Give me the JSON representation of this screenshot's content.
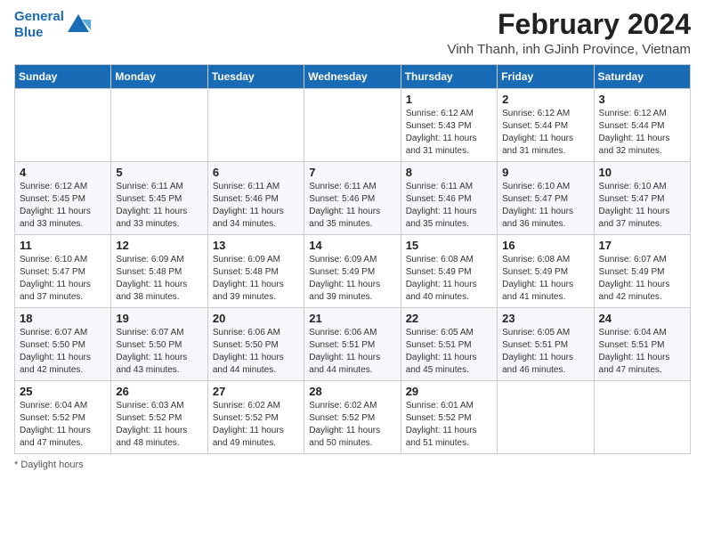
{
  "header": {
    "logo_line1": "General",
    "logo_line2": "Blue",
    "title": "February 2024",
    "subtitle": "Vinh Thanh, inh GJinh Province, Vietnam"
  },
  "columns": [
    "Sunday",
    "Monday",
    "Tuesday",
    "Wednesday",
    "Thursday",
    "Friday",
    "Saturday"
  ],
  "weeks": [
    [
      {
        "day": "",
        "info": ""
      },
      {
        "day": "",
        "info": ""
      },
      {
        "day": "",
        "info": ""
      },
      {
        "day": "",
        "info": ""
      },
      {
        "day": "1",
        "info": "Sunrise: 6:12 AM\nSunset: 5:43 PM\nDaylight: 11 hours and 31 minutes."
      },
      {
        "day": "2",
        "info": "Sunrise: 6:12 AM\nSunset: 5:44 PM\nDaylight: 11 hours and 31 minutes."
      },
      {
        "day": "3",
        "info": "Sunrise: 6:12 AM\nSunset: 5:44 PM\nDaylight: 11 hours and 32 minutes."
      }
    ],
    [
      {
        "day": "4",
        "info": "Sunrise: 6:12 AM\nSunset: 5:45 PM\nDaylight: 11 hours and 33 minutes."
      },
      {
        "day": "5",
        "info": "Sunrise: 6:11 AM\nSunset: 5:45 PM\nDaylight: 11 hours and 33 minutes."
      },
      {
        "day": "6",
        "info": "Sunrise: 6:11 AM\nSunset: 5:46 PM\nDaylight: 11 hours and 34 minutes."
      },
      {
        "day": "7",
        "info": "Sunrise: 6:11 AM\nSunset: 5:46 PM\nDaylight: 11 hours and 35 minutes."
      },
      {
        "day": "8",
        "info": "Sunrise: 6:11 AM\nSunset: 5:46 PM\nDaylight: 11 hours and 35 minutes."
      },
      {
        "day": "9",
        "info": "Sunrise: 6:10 AM\nSunset: 5:47 PM\nDaylight: 11 hours and 36 minutes."
      },
      {
        "day": "10",
        "info": "Sunrise: 6:10 AM\nSunset: 5:47 PM\nDaylight: 11 hours and 37 minutes."
      }
    ],
    [
      {
        "day": "11",
        "info": "Sunrise: 6:10 AM\nSunset: 5:47 PM\nDaylight: 11 hours and 37 minutes."
      },
      {
        "day": "12",
        "info": "Sunrise: 6:09 AM\nSunset: 5:48 PM\nDaylight: 11 hours and 38 minutes."
      },
      {
        "day": "13",
        "info": "Sunrise: 6:09 AM\nSunset: 5:48 PM\nDaylight: 11 hours and 39 minutes."
      },
      {
        "day": "14",
        "info": "Sunrise: 6:09 AM\nSunset: 5:49 PM\nDaylight: 11 hours and 39 minutes."
      },
      {
        "day": "15",
        "info": "Sunrise: 6:08 AM\nSunset: 5:49 PM\nDaylight: 11 hours and 40 minutes."
      },
      {
        "day": "16",
        "info": "Sunrise: 6:08 AM\nSunset: 5:49 PM\nDaylight: 11 hours and 41 minutes."
      },
      {
        "day": "17",
        "info": "Sunrise: 6:07 AM\nSunset: 5:49 PM\nDaylight: 11 hours and 42 minutes."
      }
    ],
    [
      {
        "day": "18",
        "info": "Sunrise: 6:07 AM\nSunset: 5:50 PM\nDaylight: 11 hours and 42 minutes."
      },
      {
        "day": "19",
        "info": "Sunrise: 6:07 AM\nSunset: 5:50 PM\nDaylight: 11 hours and 43 minutes."
      },
      {
        "day": "20",
        "info": "Sunrise: 6:06 AM\nSunset: 5:50 PM\nDaylight: 11 hours and 44 minutes."
      },
      {
        "day": "21",
        "info": "Sunrise: 6:06 AM\nSunset: 5:51 PM\nDaylight: 11 hours and 44 minutes."
      },
      {
        "day": "22",
        "info": "Sunrise: 6:05 AM\nSunset: 5:51 PM\nDaylight: 11 hours and 45 minutes."
      },
      {
        "day": "23",
        "info": "Sunrise: 6:05 AM\nSunset: 5:51 PM\nDaylight: 11 hours and 46 minutes."
      },
      {
        "day": "24",
        "info": "Sunrise: 6:04 AM\nSunset: 5:51 PM\nDaylight: 11 hours and 47 minutes."
      }
    ],
    [
      {
        "day": "25",
        "info": "Sunrise: 6:04 AM\nSunset: 5:52 PM\nDaylight: 11 hours and 47 minutes."
      },
      {
        "day": "26",
        "info": "Sunrise: 6:03 AM\nSunset: 5:52 PM\nDaylight: 11 hours and 48 minutes."
      },
      {
        "day": "27",
        "info": "Sunrise: 6:02 AM\nSunset: 5:52 PM\nDaylight: 11 hours and 49 minutes."
      },
      {
        "day": "28",
        "info": "Sunrise: 6:02 AM\nSunset: 5:52 PM\nDaylight: 11 hours and 50 minutes."
      },
      {
        "day": "29",
        "info": "Sunrise: 6:01 AM\nSunset: 5:52 PM\nDaylight: 11 hours and 51 minutes."
      },
      {
        "day": "",
        "info": ""
      },
      {
        "day": "",
        "info": ""
      }
    ]
  ],
  "footer": {
    "note": "Daylight hours"
  }
}
